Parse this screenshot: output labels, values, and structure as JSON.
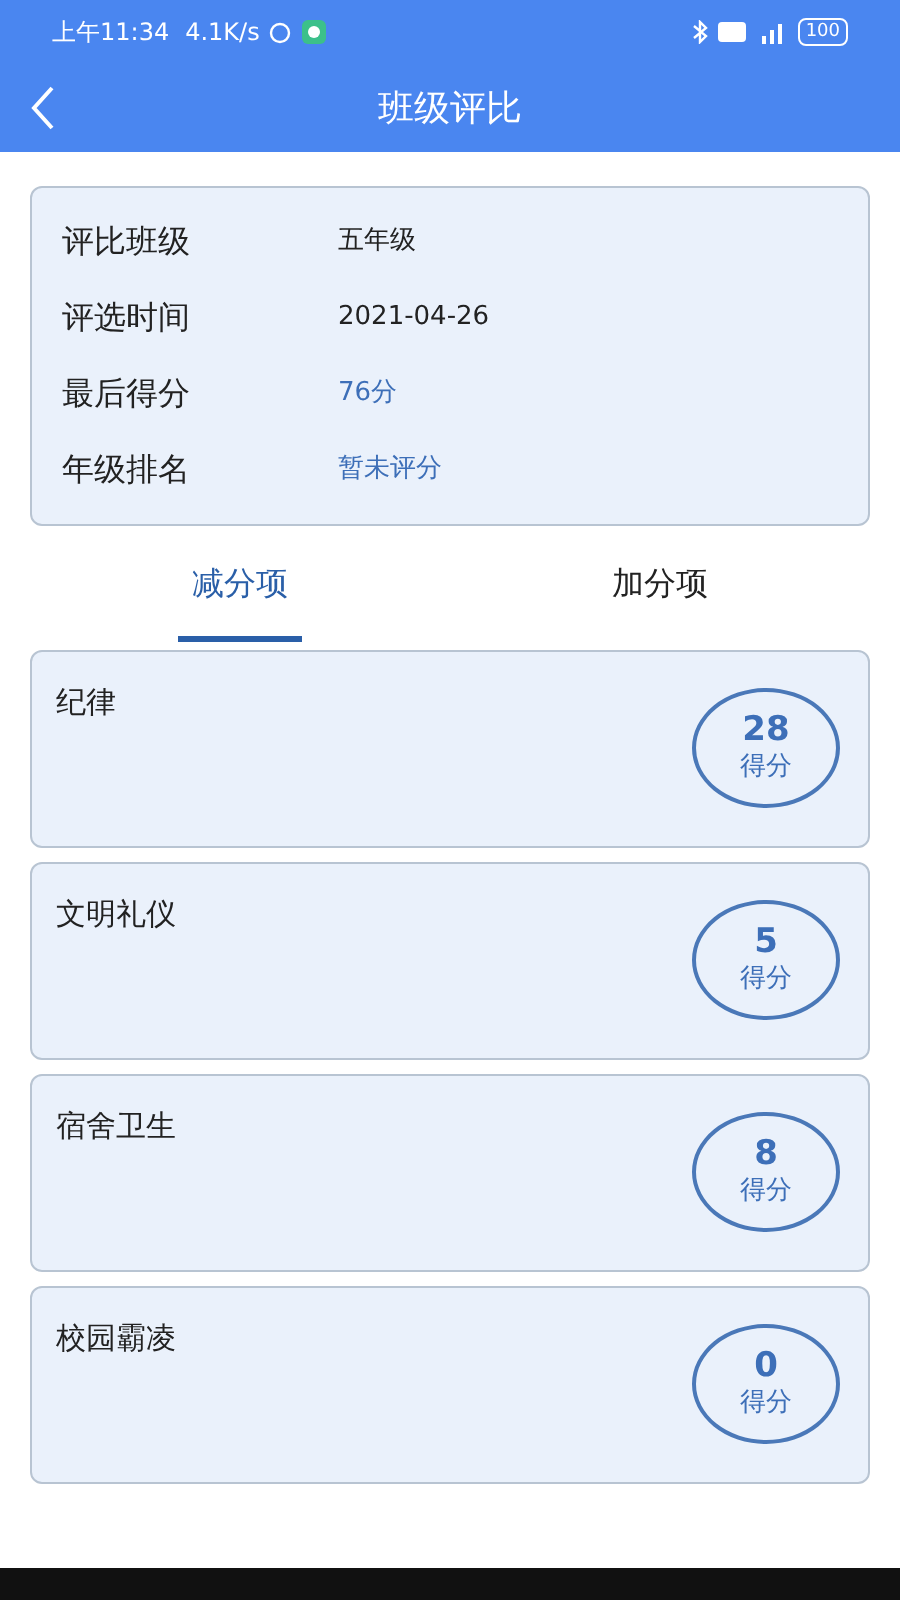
{
  "status_bar": {
    "time": "上午11:34",
    "speed": "4.1K/s",
    "battery": "100"
  },
  "header": {
    "title": "班级评比"
  },
  "info": [
    {
      "label": "评比班级",
      "value": "五年级",
      "accent": false
    },
    {
      "label": "评选时间",
      "value": "2021-04-26",
      "accent": false
    },
    {
      "label": "最后得分",
      "value": "76分",
      "accent": true
    },
    {
      "label": "年级排名",
      "value": "暂未评分",
      "accent": true
    }
  ],
  "tabs": [
    {
      "label": "减分项",
      "selected": true
    },
    {
      "label": "加分项",
      "selected": false
    }
  ],
  "items": [
    {
      "name": "纪律",
      "score": "28",
      "unit": "得分"
    },
    {
      "name": "文明礼仪",
      "score": "5",
      "unit": "得分"
    },
    {
      "name": "宿舍卫生",
      "score": "8",
      "unit": "得分"
    },
    {
      "name": "校园霸凌",
      "score": "0",
      "unit": "得分"
    }
  ]
}
